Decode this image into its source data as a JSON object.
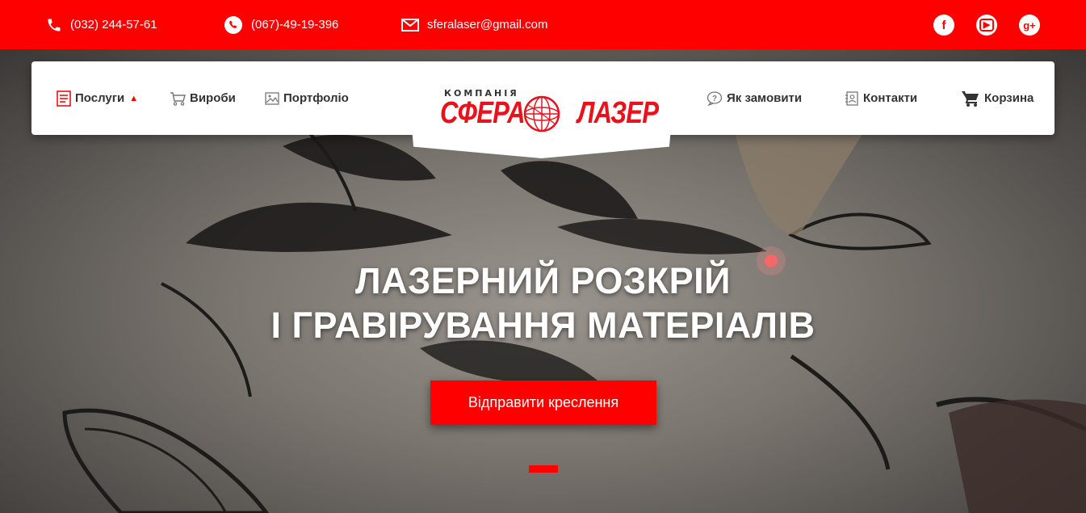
{
  "topbar": {
    "phone": "(032) 244-57-61",
    "viber": "(067)-49-19-396",
    "email": "sferalaser@gmail.com",
    "social": {
      "facebook": "f",
      "youtube": "▶",
      "googleplus": "g+"
    }
  },
  "nav": {
    "services": "Послуги",
    "products": "Вироби",
    "portfolio": "Портфоліо",
    "howto": "Як замовити",
    "contacts": "Контакти",
    "cart": "Корзина"
  },
  "logo": {
    "top": "КОМПАНІЯ",
    "word1": "СФЕРА",
    "word2": "ЛАЗЕР"
  },
  "hero": {
    "line1": "ЛАЗЕРНИЙ РОЗКРІЙ",
    "line2": "І ГРАВІРУВАННЯ МАТЕРІАЛІВ",
    "cta": "Відправити креслення"
  },
  "colors": {
    "brand_red": "#ff0000",
    "white": "#ffffff",
    "text_dark": "#333333"
  },
  "icons": [
    "phone-icon",
    "viber-icon",
    "mail-icon",
    "facebook-icon",
    "youtube-icon",
    "googleplus-icon",
    "list-icon",
    "cart-outline-icon",
    "image-icon",
    "question-icon",
    "contacts-icon",
    "cart-icon"
  ]
}
